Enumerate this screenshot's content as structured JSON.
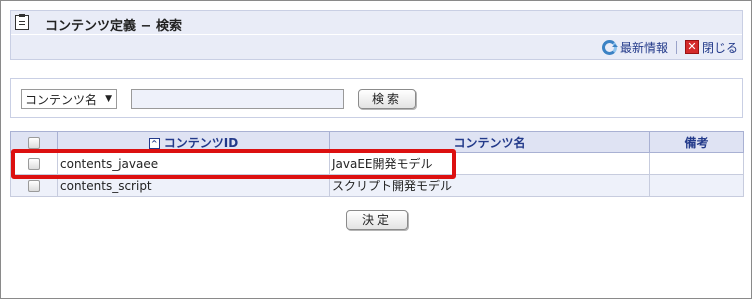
{
  "header": {
    "title": "コンテンツ定義 − 検索",
    "refresh_label": "最新情報",
    "close_label": "閉じる",
    "close_glyph": "✕"
  },
  "search": {
    "select_value": "コンテンツ名",
    "select_arrow": "▼",
    "input_value": "",
    "button_label": "検索"
  },
  "table": {
    "headers": {
      "select_all": "",
      "id": "コンテンツID",
      "name": "コンテンツ名",
      "remarks": "備考"
    },
    "sort_glyph": "^",
    "rows": [
      {
        "id": "contents_javaee",
        "name": "JavaEE開発モデル",
        "remarks": ""
      },
      {
        "id": "contents_script",
        "name": "スクリプト開発モデル",
        "remarks": ""
      }
    ]
  },
  "footer": {
    "ok_label": "決定"
  },
  "colors": {
    "highlight": "#dc1010",
    "header_bg": "#e9ecf7",
    "link": "#233a8a"
  }
}
